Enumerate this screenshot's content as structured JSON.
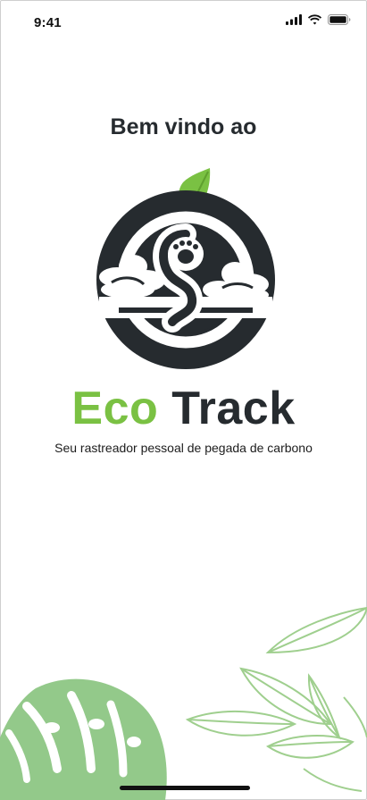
{
  "status_bar": {
    "time": "9:41",
    "icons": [
      "signal-icon",
      "wifi-icon",
      "battery-icon"
    ]
  },
  "welcome": {
    "heading": "Bem vindo ao"
  },
  "brand": {
    "name_part1": "Eco",
    "name_part2": "Track",
    "tagline": "Seu rastreador pessoal de pegada de carbono"
  },
  "colors": {
    "brand_green": "#7ac143",
    "dark": "#262b2f",
    "leaf_fill": "#93c98a",
    "leaf_outline": "#9fcf8e"
  }
}
